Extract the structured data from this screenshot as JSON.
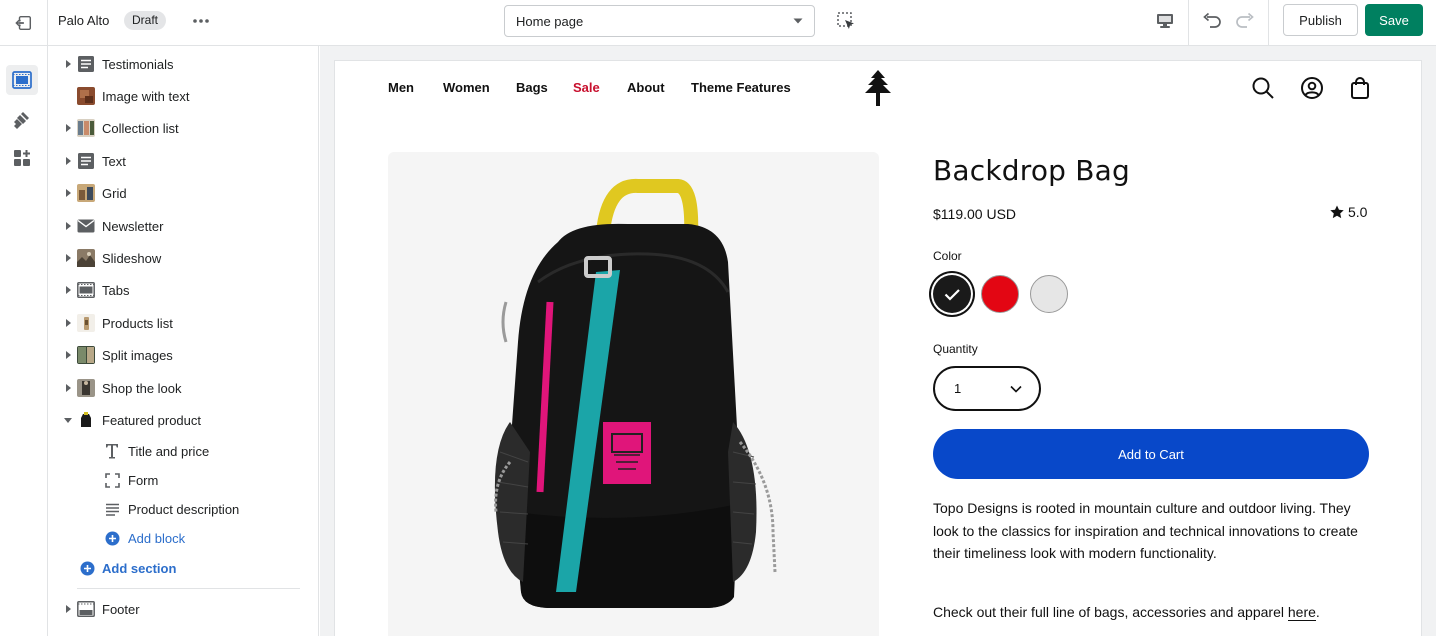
{
  "topbar": {
    "store_name": "Palo Alto",
    "status_badge": "Draft",
    "page_selector": "Home page",
    "publish_label": "Publish",
    "save_label": "Save",
    "save_color": "#008060"
  },
  "iconrail": {
    "items": [
      "sections-icon",
      "theme-settings-icon",
      "app-blocks-icon"
    ]
  },
  "sidebar": {
    "sections": [
      {
        "label": "Testimonials",
        "icon": "text-block-icon"
      },
      {
        "label": "Image with text",
        "icon": "image-thumbnail"
      },
      {
        "label": "Collection list",
        "icon": "image-thumbnail"
      },
      {
        "label": "Text",
        "icon": "text-block-icon"
      },
      {
        "label": "Grid",
        "icon": "image-thumbnail"
      },
      {
        "label": "Newsletter",
        "icon": "envelope-icon"
      },
      {
        "label": "Slideshow",
        "icon": "image-thumbnail"
      },
      {
        "label": "Tabs",
        "icon": "tabs-icon"
      },
      {
        "label": "Products list",
        "icon": "image-thumbnail"
      },
      {
        "label": "Split images",
        "icon": "image-thumbnail"
      },
      {
        "label": "Shop the look",
        "icon": "image-thumbnail"
      },
      {
        "label": "Featured product",
        "icon": "backpack-thumbnail"
      }
    ],
    "blocks": [
      {
        "label": "Title and price",
        "icon": "title-icon"
      },
      {
        "label": "Form",
        "icon": "form-frame-icon"
      },
      {
        "label": "Product description",
        "icon": "paragraph-icon"
      }
    ],
    "add_block": "Add block",
    "add_section": "Add section",
    "footer": "Footer"
  },
  "storefront": {
    "nav": [
      "Men",
      "Women",
      "Bags",
      "Sale",
      "About",
      "Theme Features"
    ],
    "sale_color": "#c8102e",
    "product": {
      "title": "Backdrop Bag",
      "price": "$119.00 USD",
      "rating": "5.0",
      "color_label": "Color",
      "colors": [
        "#1a1a1a",
        "#e30613",
        "#e6e6e6"
      ],
      "selected_color_index": 0,
      "quantity_label": "Quantity",
      "quantity": "1",
      "add_to_cart": "Add to Cart",
      "button_color": "#0848c9",
      "description": "Topo Designs is rooted in mountain culture and outdoor living. They look to the classics for inspiration and technical innovations to create their timeliness look with modern functionality.",
      "description2_prefix": "Check out their full line of bags, accessories and apparel ",
      "description2_link": "here",
      "description2_suffix": "."
    }
  }
}
